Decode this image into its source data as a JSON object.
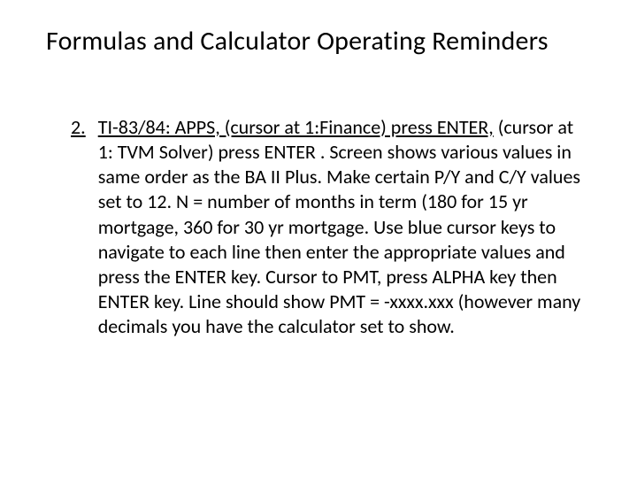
{
  "title": "Formulas and Calculator Operating Reminders",
  "list": {
    "marker": "2.",
    "lead_underlined": "TI-83/84: APPS, (cursor at 1:Finance) press ENTER,",
    "rest": " (cursor at 1: TVM Solver) press ENTER . Screen shows various values in same order as the BA II Plus. Make certain P/Y and C/Y values set to 12. N = number of months in term (180 for 15 yr mortgage, 360 for 30 yr mortgage. Use blue cursor keys to navigate to each line then enter the appropriate values and press the ENTER key. Cursor to PMT, press ALPHA key then ENTER key. Line should show PMT = -xxxx.xxx (however many decimals you have the calculator set to show."
  }
}
